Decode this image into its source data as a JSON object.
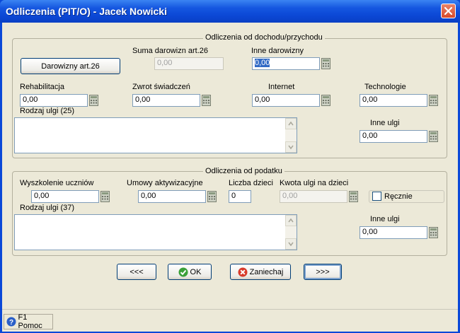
{
  "window": {
    "title": "Odliczenia (PIT/O) - Jacek Nowicki"
  },
  "income": {
    "group_title": "Odliczenia od dochodu/przychodu",
    "donations_button": "Darowizny art.26",
    "suma_label": "Suma darowizn art.26",
    "suma_value": "0,00",
    "inne_dar_label": "Inne darowizny",
    "inne_dar_value": "0,00",
    "rehab_label": "Rehabilitacja",
    "rehab_value": "0,00",
    "zwrot_label": "Zwrot świadczeń",
    "zwrot_value": "0,00",
    "internet_label": "Internet",
    "internet_value": "0,00",
    "tech_label": "Technologie",
    "tech_value": "0,00",
    "rodzaj_label": "Rodzaj ulgi (25)",
    "inne_ulgi_label": "Inne ulgi",
    "inne_ulgi_value": "0,00"
  },
  "tax": {
    "group_title": "Odliczenia od podatku",
    "wysz_label": "Wyszkolenie uczniów",
    "wysz_value": "0,00",
    "umowy_label": "Umowy aktywizacyjne",
    "umowy_value": "0,00",
    "liczba_label": "Liczba dzieci",
    "liczba_value": "0",
    "kwota_label": "Kwota ulgi na dzieci",
    "kwota_value": "0,00",
    "recznie_label": "Ręcznie",
    "rodzaj_label": "Rodzaj ulgi (37)",
    "inne_ulgi_label": "Inne ulgi",
    "inne_ulgi_value": "0,00"
  },
  "buttons": {
    "prev": "<<<",
    "ok": "OK",
    "cancel": "Zaniechaj",
    "next": ">>>"
  },
  "status": {
    "help": "F1 Pomoc"
  }
}
